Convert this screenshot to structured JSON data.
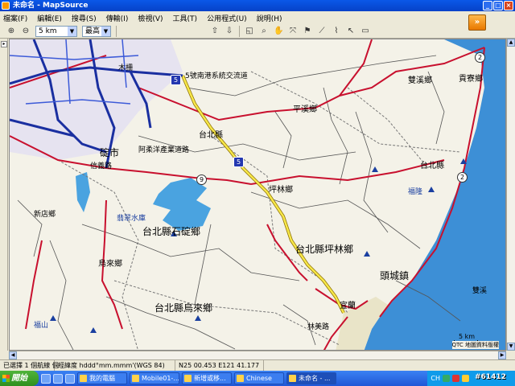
{
  "window": {
    "title": "未命名 - MapSource"
  },
  "menu": [
    "檔案(F)",
    "編輯(E)",
    "搜尋(S)",
    "傳輸(I)",
    "檢視(V)",
    "工具(T)",
    "公用程式(U)",
    "說明(H)"
  ],
  "toolbar": {
    "zoom_value": "5 km",
    "detail_value": "最高"
  },
  "map": {
    "labels": {
      "interchange": "5號南港系統交流道",
      "pingxi": "平溪鄉",
      "shuangxi": "雙溪鄉",
      "gongliao": "貢寮鄉",
      "shiding_county": "台北縣",
      "agri_road": "阿柔洋產業道路",
      "shihding_city": "碇市",
      "pinglin_county": "坪林鄉",
      "taipei_county_e": "台北縣",
      "feicui": "翡翠水庫",
      "shiding": "台北縣石碇鄉",
      "pinglin": "台北縣坪林鄉",
      "toucheng": "頭城鎮",
      "wulai_short": "烏來鄉",
      "wulai": "台北縣烏來鄉",
      "yilan_county": "宜蘭",
      "xindian": "新店鄉",
      "xinwu": "信義路",
      "fushan": "福山",
      "linmei": "林美路",
      "shuangxing": "雙溪",
      "shihpai": "頭城",
      "keelung_e": "雙溪",
      "muzhi": "木柵",
      "fulong": "福隆",
      "road_9": "9",
      "road_5a": "5",
      "road_5b": "5",
      "road_2a": "2",
      "road_2b": "2",
      "scale": "5 km",
      "copyright": "QTC 地圖資料版權"
    }
  },
  "status": {
    "selection": "已選擇 1 個航線 個",
    "format": "經緯度 hddd°mm.mmm'(WGS 84)",
    "coords": "N25 00.453 E121 41.177"
  },
  "taskbar": {
    "start": "開始",
    "tasks": [
      "我的電腦",
      "Mobile01-...",
      "新增或移...",
      "Chinese",
      "未命名 - ..."
    ],
    "tray_text": "CH",
    "watermark": "#61412"
  },
  "colors": {
    "titlebar": "#0a58e8",
    "taskbar": "#2057d6",
    "sea": "#3d8fd6",
    "major_road": "#c8102e",
    "highway": "#1a2fa0"
  }
}
